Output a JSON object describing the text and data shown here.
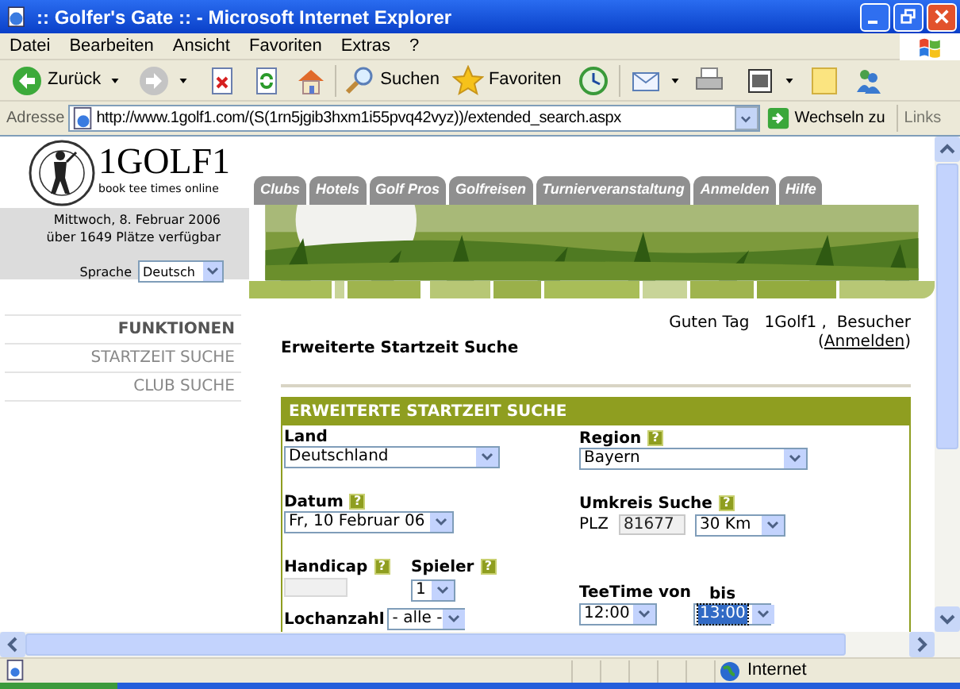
{
  "window": {
    "title": ":: Golfer's Gate :: - Microsoft Internet Explorer"
  },
  "menu": [
    "Datei",
    "Bearbeiten",
    "Ansicht",
    "Favoriten",
    "Extras",
    "?"
  ],
  "toolbar": {
    "back_label": "Zurück",
    "search_label": "Suchen",
    "favorites_label": "Favoriten"
  },
  "address_bar": {
    "label": "Adresse",
    "url": "http://www.1golf1.com/(S(1rn5jgib3hxm1i55pvq42vyz))/extended_search.aspx",
    "go_label": "Wechseln zu",
    "links_label": "Links"
  },
  "site": {
    "logo_text": "1GOLF1",
    "tagline": "book tee times online",
    "date": "Mittwoch, 8. Februar 2006",
    "availability": "über 1649  Plätze verfügbar",
    "language_label": "Sprache",
    "language": "Deutsch"
  },
  "tabs": [
    "Clubs",
    "Hotels",
    "Golf Pros",
    "Golfreisen",
    "Turnierveranstaltung",
    "Anmelden",
    "Hilfe"
  ],
  "sidebar": [
    {
      "kind": "heading",
      "label": "FUNKTIONEN"
    },
    {
      "kind": "link",
      "label": "STARTZEIT SUCHE"
    },
    {
      "kind": "link",
      "label": "CLUB SUCHE"
    }
  ],
  "greeting": "Guten Tag   1Golf1 ,  Besucher",
  "login_link": {
    "before": "(",
    "label": "Anmelden",
    "after": ")"
  },
  "page_heading": "Erweiterte Startzeit Suche",
  "form": {
    "title": "ERWEITERTE STARTZEIT SUCHE",
    "land": {
      "label": "Land",
      "value": "Deutschland"
    },
    "region": {
      "label": "Region",
      "help": "?",
      "value": "Bayern"
    },
    "datum": {
      "label": "Datum",
      "help": "?",
      "value": "Fr, 10 Februar 06"
    },
    "umkreis": {
      "label": "Umkreis Suche",
      "help": "?",
      "plz_label": "PLZ",
      "plz": "81677",
      "radius": "30 Km"
    },
    "handicap": {
      "label": "Handicap",
      "help": "?",
      "disabled": true
    },
    "spieler": {
      "label": "Spieler",
      "help": "?",
      "value": "1"
    },
    "teetime": {
      "label": "TeeTime von",
      "value": "12:00",
      "to_label": "bis",
      "to_value": "13:00",
      "to_selected": true
    },
    "lochanzahl": {
      "label": "Lochanzahl",
      "value": "- alle -"
    }
  },
  "status_bar": {
    "zone": "Internet"
  }
}
